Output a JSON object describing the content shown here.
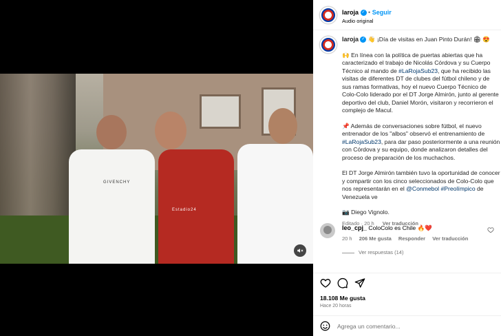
{
  "post": {
    "username": "laroja",
    "follow_label": "Seguir",
    "audio_label": "Audio original",
    "caption_title": "¡Día de visitas en Juan Pinto Durán!",
    "caption_p1_a": "En línea con la política de puertas abiertas que ha caracterizado el trabajo de Nicolás Córdova y su Cuerpo Técnico al mando de ",
    "tag_sub23": "#LaRojaSub23",
    "caption_p1_b": ", que ha recibido las visitas de diferentes DT de clubes del fútbol chileno y de sus ramas formativas, hoy el nuevo Cuerpo Técnico de Colo-Colo liderado por el DT Jorge Almirón, junto al gerente deportivo del club, Daniel Morón, visitaron y recorrieron el complejo de Macul.",
    "caption_p2_a": "Además de conversaciones sobre fútbol, el nuevo entrenador de los \"albos\" observó el entrenamiento de ",
    "caption_p2_b": ", para dar paso posteriormente a una reunión con Córdova y su equipo, donde analizaron detalles del proceso de preparación de los muchachos.",
    "caption_p3_a": "El DT Jorge Almirón también tuvo la oportunidad de conocer y compartir con los cinco seleccionados de Colo-Colo que nos representarán en el ",
    "tag_conmebol": "@Conmebol",
    "tag_preolimpico": "#Preolímpico",
    "caption_p3_b": " de Venezuela ve",
    "credit": "Diego Vignolo.",
    "edited": "Editado · 20 h",
    "see_translation": "Ver traducción"
  },
  "comment": {
    "username": "leo_cpj_",
    "text": "ColoColo es Chile",
    "time": "20 h",
    "likes": "206 Me gusta",
    "reply": "Responder",
    "translate": "Ver traducción",
    "see_replies": "Ver respuestas (14)"
  },
  "footer": {
    "likes": "18.108 Me gusta",
    "time": "Hace 20 horas",
    "add_comment_placeholder": "Agrega un comentario..."
  },
  "video": {
    "shirt_text": "GIVENCHY",
    "jersey_text": "Estadio24"
  }
}
